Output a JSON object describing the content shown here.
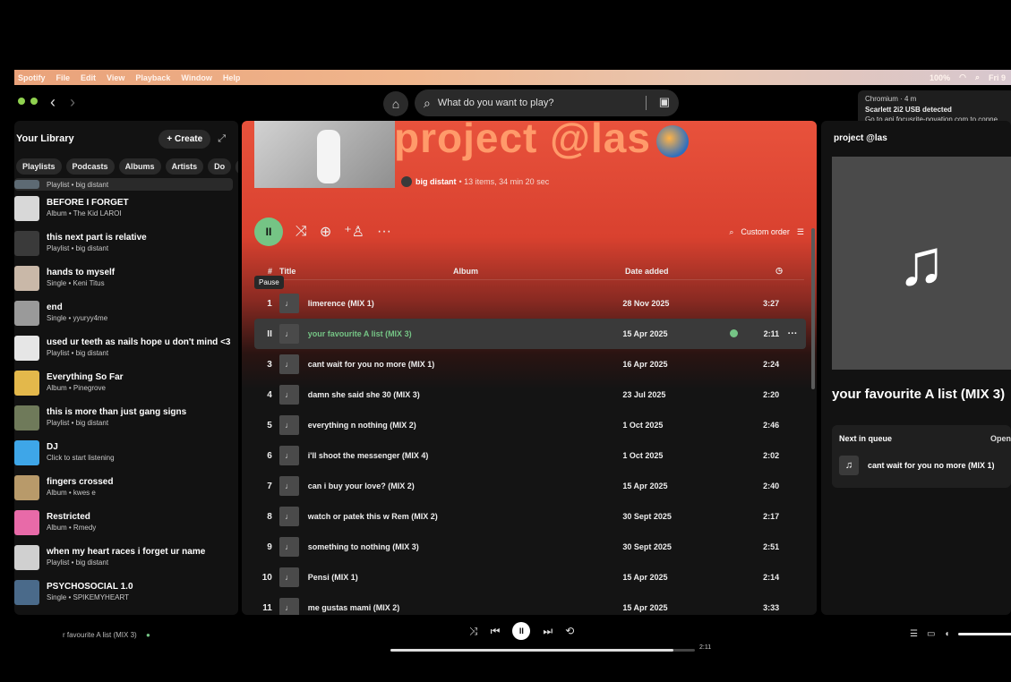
{
  "menubar": {
    "items": [
      "Spotify",
      "File",
      "Edit",
      "View",
      "Playback",
      "Window",
      "Help"
    ],
    "battery": "100%",
    "clock": "Fri 9"
  },
  "topbar": {
    "search_placeholder": "What do you want to play?"
  },
  "notification": {
    "app": "Chromium · 4 m",
    "title": "Scarlett 2i2 USB detected",
    "body": "Go to api.focusrite-novation.com to conne"
  },
  "library": {
    "title": "Your Library",
    "create_label": "Create",
    "chips": [
      "Playlists",
      "Podcasts",
      "Albums",
      "Artists",
      "Do"
    ],
    "items": [
      {
        "name": "",
        "sub": "Playlist • big distant",
        "color": "#5d6a73"
      },
      {
        "name": "BEFORE I FORGET",
        "sub": "Album • The Kid LAROI",
        "color": "#d8d8d8"
      },
      {
        "name": "this next part is relative",
        "sub": "Playlist • big distant",
        "color": "#3a3a3a"
      },
      {
        "name": "hands to myself",
        "sub": "Single • Keni Titus",
        "color": "#c9b8a8"
      },
      {
        "name": "end",
        "sub": "Single • yyuryy4me",
        "color": "#9a9a9a"
      },
      {
        "name": "used ur teeth as nails hope u don't mind <3",
        "sub": "Playlist • big distant",
        "color": "#e6e6e6"
      },
      {
        "name": "Everything So Far",
        "sub": "Album • Pinegrove",
        "color": "#e3b84b"
      },
      {
        "name": "this is more than just gang signs",
        "sub": "Playlist • big distant",
        "color": "#6f7a5a"
      },
      {
        "name": "DJ",
        "sub": "Click to start listening",
        "color": "#3ea6e8"
      },
      {
        "name": "fingers crossed",
        "sub": "Album • kwes e",
        "color": "#b89a6a"
      },
      {
        "name": "Restricted",
        "sub": "Album • Rmedy",
        "color": "#e86aa8"
      },
      {
        "name": "when my heart races i forget ur name",
        "sub": "Playlist • big distant",
        "color": "#d0d0d0"
      },
      {
        "name": "PSYCHOSOCIAL 1.0",
        "sub": "Single • SPIKEMYHEART",
        "color": "#4a6a8a"
      }
    ]
  },
  "playlist": {
    "title": "project @las",
    "owner": "big distant",
    "meta": "• 13 items, 34 min 20 sec",
    "custom_order": "Custom order",
    "tooltip": "Pause",
    "headers": {
      "num": "#",
      "title": "Title",
      "album": "Album",
      "date": "Date added"
    },
    "tracks": [
      {
        "num": "1",
        "title": "limerence (MIX 1)",
        "date": "28 Nov 2025",
        "dur": "3:27"
      },
      {
        "num": "",
        "title": "your favourite A list (MIX 3)",
        "date": "15 Apr 2025",
        "dur": "2:11",
        "active": true
      },
      {
        "num": "3",
        "title": "cant wait for you no more (MIX 1)",
        "date": "16 Apr 2025",
        "dur": "2:24"
      },
      {
        "num": "4",
        "title": "damn she said she 30 (MIX 3)",
        "date": "23 Jul 2025",
        "dur": "2:20"
      },
      {
        "num": "5",
        "title": "everything n nothing (MIX 2)",
        "date": "1 Oct 2025",
        "dur": "2:46"
      },
      {
        "num": "6",
        "title": "i'll shoot the messenger (MIX 4)",
        "date": "1 Oct 2025",
        "dur": "2:02"
      },
      {
        "num": "7",
        "title": "can i buy your love? (MIX 2)",
        "date": "15 Apr 2025",
        "dur": "2:40"
      },
      {
        "num": "8",
        "title": "watch or patek this w Rem (MIX 2)",
        "date": "30 Sept 2025",
        "dur": "2:17"
      },
      {
        "num": "9",
        "title": "something to nothing (MIX 3)",
        "date": "30 Sept 2025",
        "dur": "2:51"
      },
      {
        "num": "10",
        "title": "Pensi (MIX 1)",
        "date": "15 Apr 2025",
        "dur": "2:14"
      },
      {
        "num": "11",
        "title": "me gustas mami (MIX 2)",
        "date": "15 Apr 2025",
        "dur": "3:33"
      }
    ]
  },
  "right_panel": {
    "header": "project @las",
    "track_title": "your favourite A list (MIX 3)",
    "queue_header": "Next in queue",
    "queue_open": "Open",
    "queue_item": "cant wait for you no more (MIX 1)"
  },
  "player": {
    "now_playing": "r favourite A list (MIX 3)",
    "elapsed": "2:11",
    "progress_fraction": 0.93
  }
}
